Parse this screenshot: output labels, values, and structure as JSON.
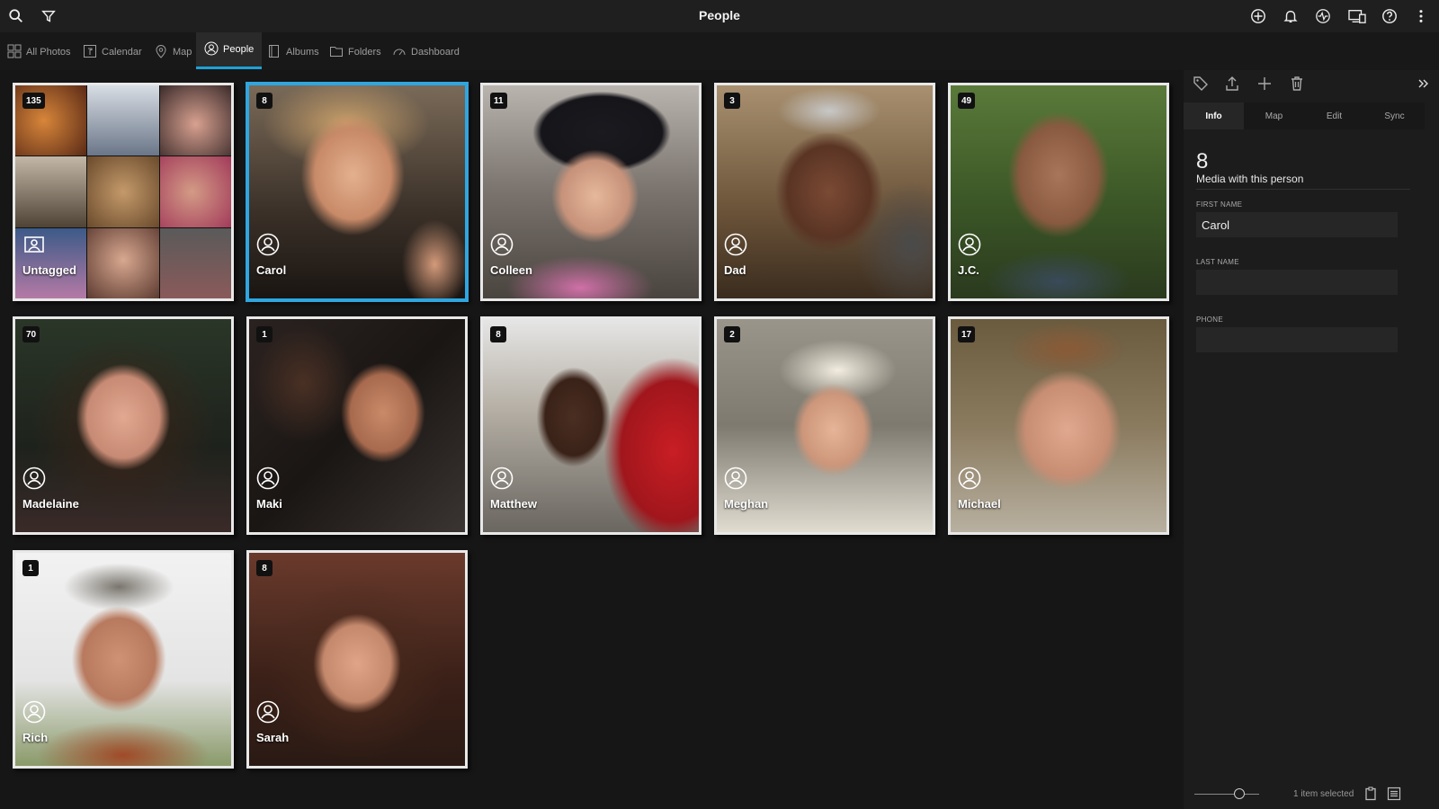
{
  "app": {
    "title": "People"
  },
  "toolbar": {
    "left_icons": [
      "search-icon",
      "filter-icon"
    ],
    "right_icons": [
      "add-circle-icon",
      "bell-icon",
      "activity-icon",
      "devices-icon",
      "help-icon",
      "more-vert-icon"
    ]
  },
  "nav": {
    "items": [
      {
        "label": "All Photos",
        "icon": "grid-icon"
      },
      {
        "label": "Calendar",
        "icon": "calendar-icon"
      },
      {
        "label": "Map",
        "icon": "map-pin-icon"
      },
      {
        "label": "People",
        "icon": "person-icon",
        "active": true
      },
      {
        "label": "Albums",
        "icon": "album-icon"
      },
      {
        "label": "Folders",
        "icon": "folder-icon"
      },
      {
        "label": "Dashboard",
        "icon": "dashboard-icon"
      }
    ]
  },
  "people": [
    {
      "name": "Untagged",
      "count": "135"
    },
    {
      "name": "Carol",
      "count": "8",
      "selected": true
    },
    {
      "name": "Colleen",
      "count": "11"
    },
    {
      "name": "Dad",
      "count": "3"
    },
    {
      "name": "J.C.",
      "count": "49"
    },
    {
      "name": "Madelaine",
      "count": "70"
    },
    {
      "name": "Maki",
      "count": "1"
    },
    {
      "name": "Matthew",
      "count": "8"
    },
    {
      "name": "Meghan",
      "count": "2"
    },
    {
      "name": "Michael",
      "count": "17"
    },
    {
      "name": "Rich",
      "count": "1"
    },
    {
      "name": "Sarah",
      "count": "8"
    }
  ],
  "panel": {
    "toolbar_icons": [
      "tag-icon",
      "share-icon",
      "plus-icon",
      "trash-icon",
      "collapse-icon"
    ],
    "tabs": [
      "Info",
      "Map",
      "Edit",
      "Sync"
    ],
    "active_tab": "Info",
    "media_count": "8",
    "media_label": "Media with this person",
    "fields": {
      "first_name_label": "FIRST NAME",
      "first_name_value": "Carol",
      "last_name_label": "LAST NAME",
      "last_name_value": "",
      "phone_label": "PHONE",
      "phone_value": ""
    },
    "footer": {
      "selection_text": "1 item selected"
    }
  },
  "colors": {
    "accent": "#1ea1d6",
    "selected_border": "#2fa6e0",
    "background": "#161616"
  }
}
